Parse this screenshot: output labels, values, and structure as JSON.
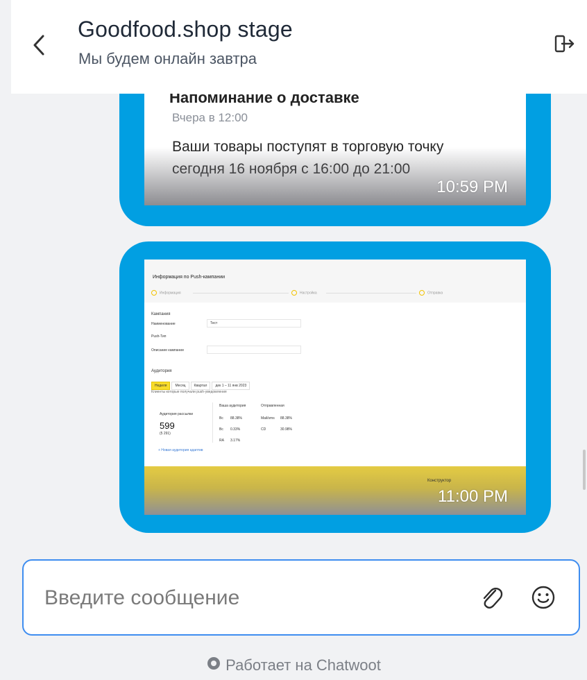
{
  "header": {
    "title": "Goodfood.shop stage",
    "subtitle": "Мы будем онлайн завтра",
    "back_icon": "chevron-left-icon",
    "exit_icon": "sign-out-icon"
  },
  "messages": [
    {
      "type": "card",
      "heading_partial": "Напоминание о доставке",
      "date": "Вчера в 12:00",
      "text": "Ваши товары поступят в торговую точку сегодня 16 ноября с 16:00 до 21:00",
      "time": "10:59 PM"
    },
    {
      "type": "image",
      "time": "11:00 PM",
      "screenshot": {
        "title": "Информация по Push-кампании",
        "steps": [
          "Информация",
          "Настройка",
          "Отправка"
        ],
        "section_campaign": "Кампания",
        "field_labels": [
          "Наименование",
          "Push-Тип",
          "Описание кампании"
        ],
        "field_value": "Тест",
        "section_audience": "Аудитория",
        "audience_tabs": [
          "Неделя",
          "Месяц",
          "Квартал",
          "Год"
        ],
        "date_range": "дек 1 – 11 янв 2023",
        "audience_note": "Клиенты которые получали push-уведомления",
        "audience_label": "Аудитория рассылки",
        "audience_value": "599",
        "audience_sub": "(5 291)",
        "col_headers": [
          "Ваша аудитория",
          "Отправленная"
        ],
        "rows": [
          [
            "Bc",
            "88.38%",
            "Mail/sms",
            "88.38%"
          ],
          [
            "Bc",
            "0.33%",
            "CD",
            "30.98%"
          ],
          [
            "RA",
            "3.17%",
            "",
            ""
          ]
        ],
        "link": "+ Новая аудитория адаптив",
        "footer_text": "Конструктор"
      }
    }
  ],
  "composer": {
    "placeholder": "Введите сообщение",
    "attach_icon": "paperclip-icon",
    "emoji_icon": "emoji-smile-icon"
  },
  "branding": {
    "text": "Работает на Chatwoot",
    "logo_icon": "chatwoot-logo-icon"
  },
  "colors": {
    "bubble": "#019fe2",
    "focus_border": "#3e8df0",
    "background": "#f1f2f4"
  }
}
